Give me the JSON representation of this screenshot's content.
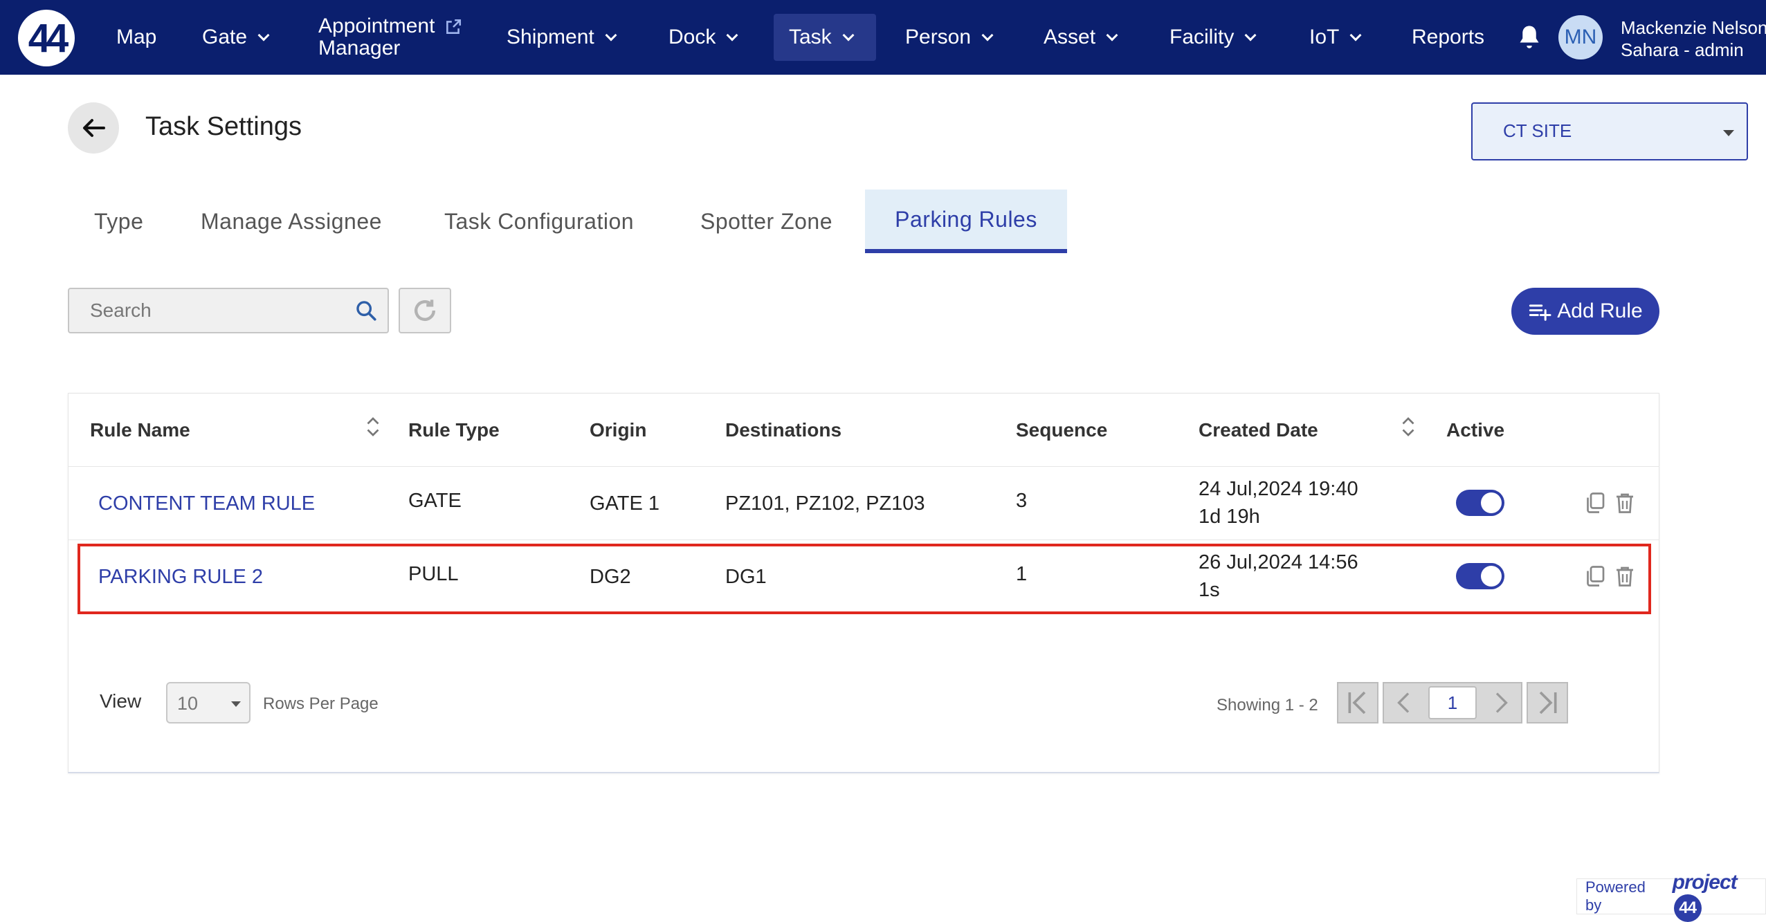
{
  "nav": {
    "logo": "44",
    "items": [
      {
        "label": "Map",
        "dropdown": false
      },
      {
        "label": "Gate",
        "dropdown": true
      },
      {
        "label_line1": "Appointment",
        "label_line2": "Manager",
        "external": true
      },
      {
        "label": "Shipment",
        "dropdown": true
      },
      {
        "label": "Dock",
        "dropdown": true
      },
      {
        "label": "Task",
        "dropdown": true,
        "active": true
      },
      {
        "label": "Person",
        "dropdown": true
      },
      {
        "label": "Asset",
        "dropdown": true
      },
      {
        "label": "Facility",
        "dropdown": true
      },
      {
        "label": "IoT",
        "dropdown": true
      },
      {
        "label": "Reports",
        "dropdown": false
      }
    ],
    "user": {
      "initials": "MN",
      "name": "Mackenzie Nelson",
      "role": "Sahara - admin"
    }
  },
  "page": {
    "title": "Task Settings",
    "site_select": {
      "value": "CT SITE"
    }
  },
  "tabs": [
    {
      "label": "Type"
    },
    {
      "label": "Manage Assignee"
    },
    {
      "label": "Task Configuration"
    },
    {
      "label": "Spotter Zone"
    },
    {
      "label": "Parking Rules",
      "active": true
    }
  ],
  "toolbar": {
    "search_placeholder": "Search",
    "add_rule_label": "Add Rule"
  },
  "table": {
    "columns": [
      "Rule Name",
      "Rule Type",
      "Origin",
      "Destinations",
      "Sequence",
      "Created Date",
      "Active"
    ],
    "rows": [
      {
        "rule_name": "CONTENT TEAM RULE",
        "rule_type": "GATE",
        "origin": "GATE 1",
        "destinations": "PZ101, PZ102, PZ103",
        "sequence": "3",
        "created_date": "24 Jul,2024 19:40",
        "created_ago": "1d 19h",
        "active": true
      },
      {
        "rule_name": "PARKING RULE 2",
        "rule_type": "PULL",
        "origin": "DG2",
        "destinations": "DG1",
        "sequence": "1",
        "created_date": "26 Jul,2024 14:56",
        "created_ago": "1s",
        "active": true,
        "highlighted": true
      }
    ]
  },
  "pagination": {
    "view_label": "View",
    "rows_per_page": "10",
    "rows_per_page_label": "Rows Per Page",
    "showing": "Showing 1 - 2",
    "current_page": "1"
  },
  "footer": {
    "powered_by": "Powered by",
    "brand": "project",
    "brand_mark": "44"
  },
  "colors": {
    "nav_bg": "#0b1f6e",
    "accent": "#2e3ea8",
    "highlight_border": "#e0281e"
  }
}
